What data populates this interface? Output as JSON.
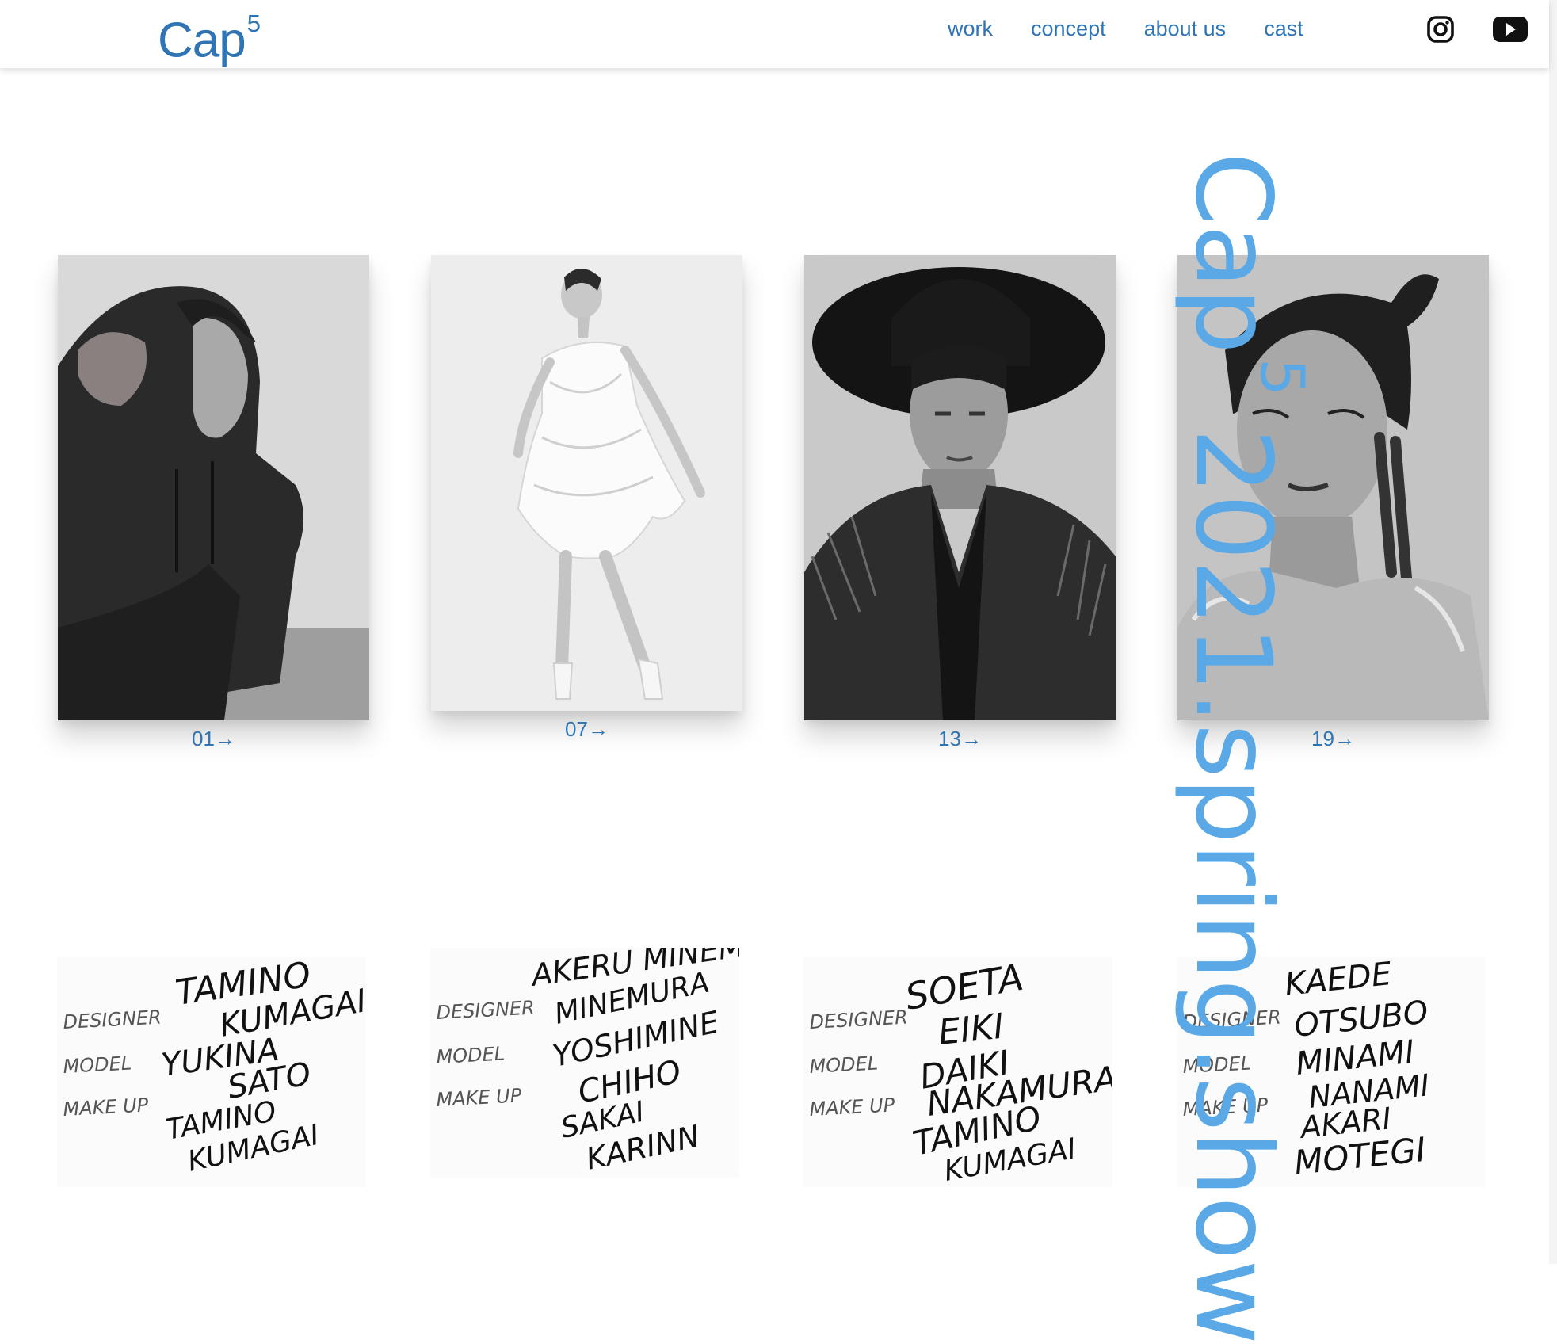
{
  "header": {
    "logo_text": "Cap",
    "logo_sup": "5",
    "nav": [
      {
        "label": "work"
      },
      {
        "label": "concept"
      },
      {
        "label": "about us"
      },
      {
        "label": "cast"
      }
    ],
    "icons": [
      "instagram-icon",
      "youtube-icon"
    ]
  },
  "gallery": {
    "items": [
      {
        "number": "01→"
      },
      {
        "number": "07→"
      },
      {
        "number": "13→"
      },
      {
        "number": "19→"
      }
    ]
  },
  "credits": {
    "row_labels": [
      "DESIGNER",
      "MODEL",
      "MAKE UP"
    ],
    "items": [
      {
        "names": [
          "TAMINO KUMAGAI",
          "YUKINA SATO",
          "TAMINO KUMAGAI"
        ]
      },
      {
        "names": [
          "AKERU MINEMURA",
          "YOSHIMINE CHIHO",
          "SAKAI KARINN"
        ]
      },
      {
        "names": [
          "SOETA EIKI",
          "DAIKI NAKAMURA",
          "TAMINO KUMAGAI"
        ]
      },
      {
        "names": [
          "KAEDE OTSUBO",
          "MINAMI NANAMI",
          "AKARI MOTEGI"
        ]
      }
    ]
  },
  "vertical_title": {
    "main": "Cap",
    "sup": "5",
    "rest": " 2021.spring.show"
  },
  "colors": {
    "accent": "#2f74b5",
    "vertical_text": "#5aa8e6"
  }
}
